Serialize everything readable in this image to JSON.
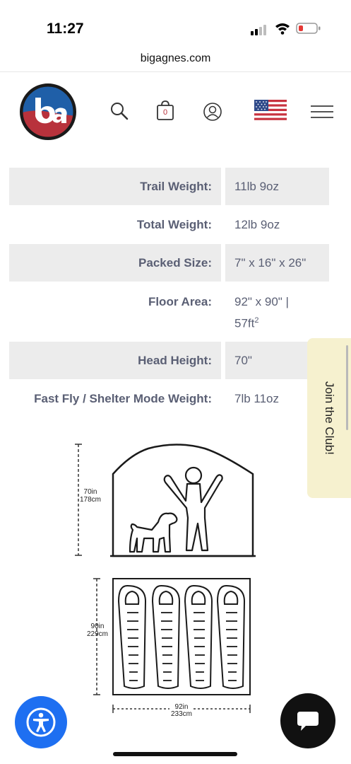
{
  "status_bar": {
    "time": "11:27"
  },
  "browser": {
    "url": "bigagnes.com"
  },
  "header": {
    "logo": "big-agnes-logo",
    "cart_count": "0",
    "icons": [
      "search-icon",
      "shopping-bag-icon",
      "account-icon",
      "us-flag-icon",
      "hamburger-menu-icon"
    ]
  },
  "specs": [
    {
      "label": "Trail Weight:",
      "value": "11lb 9oz",
      "shaded": true
    },
    {
      "label": "Total Weight:",
      "value": "12lb 9oz",
      "shaded": false
    },
    {
      "label": "Packed Size:",
      "value": "7\" x 16\" x 26\"",
      "shaded": true
    },
    {
      "label": "Floor Area:",
      "value_line1": "92\" x 90\" |",
      "value_line2": "57ft",
      "value_sup": "2",
      "shaded": false
    },
    {
      "label": "Head Height:",
      "value": "70\"",
      "shaded": true
    },
    {
      "label": "Fast Fly / Shelter Mode Weight:",
      "value": "7lb 11oz",
      "shaded": false
    }
  ],
  "diagram": {
    "height_in": "70in",
    "height_cm": "178cm",
    "depth_in": "90in",
    "depth_cm": "229cm",
    "width_in": "92in",
    "width_cm": "233cm"
  },
  "join_tab": "Join the Club!",
  "colors": {
    "brand_red": "#b8323c",
    "brand_blue": "#1f5fa8",
    "tab_yellow": "#f6f1cf",
    "a11y_blue": "#1e6ff1"
  }
}
